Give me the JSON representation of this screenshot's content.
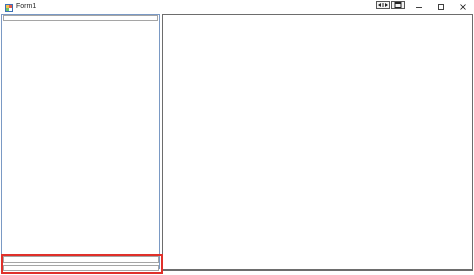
{
  "window": {
    "title": "Form1",
    "icons": {
      "app": "winforms-app-icon",
      "toolbar_left": "split-arrows-icon",
      "toolbar_right": "window-restore-icon",
      "minimize": "minimize-icon",
      "maximize": "maximize-icon",
      "close": "close-icon"
    }
  },
  "form": {
    "left_top_input": {
      "value": ""
    },
    "bottom_input_1": {
      "value": ""
    },
    "bottom_input_2": {
      "value": ""
    }
  },
  "colors": {
    "highlight": "#e0302a",
    "panel_border": "#7a99c4"
  }
}
